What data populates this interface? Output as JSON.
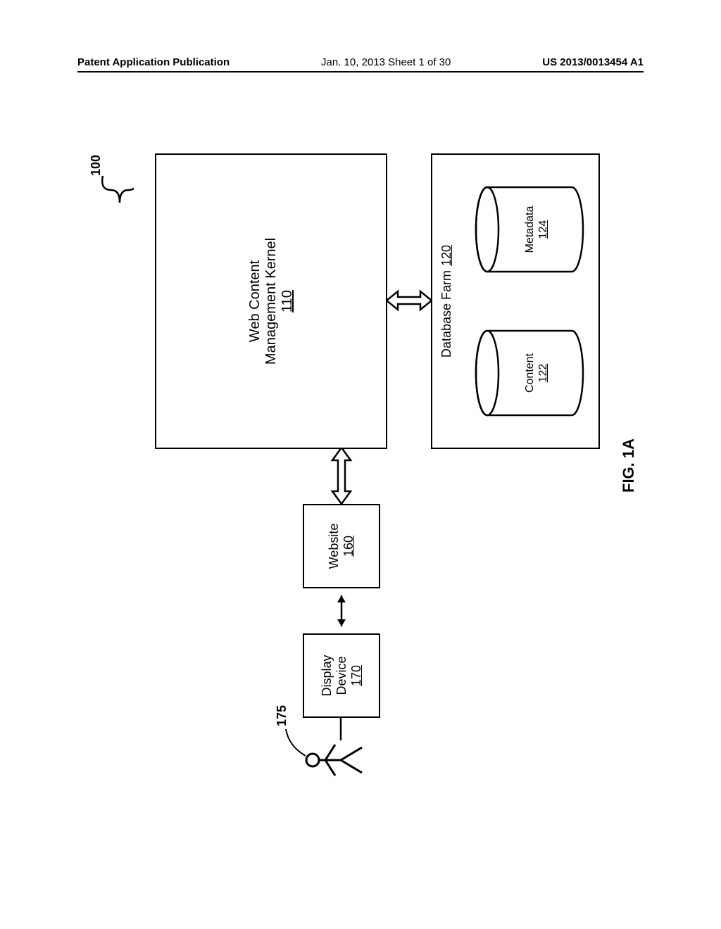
{
  "header": {
    "left": "Patent Application Publication",
    "center": "Jan. 10, 2013  Sheet 1 of 30",
    "right": "US 2013/0013454 A1"
  },
  "figure_label": "FIG. 1A",
  "ref_system": "100",
  "ref_user": "175",
  "blocks": {
    "display_device": {
      "title": "Display Device",
      "ref": "170"
    },
    "website": {
      "title": "Website",
      "ref": "160"
    },
    "kernel": {
      "line1": "Web Content",
      "line2": "Management Kernel",
      "ref": "110"
    },
    "dbfarm": {
      "title": "Database Farm",
      "ref": "120"
    },
    "content": {
      "title": "Content",
      "ref": "122"
    },
    "metadata": {
      "title": "Metadata",
      "ref": "124"
    }
  }
}
